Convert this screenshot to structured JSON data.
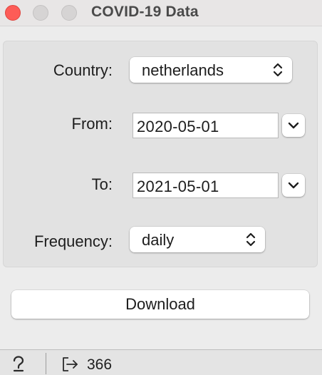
{
  "window": {
    "title": "COVID-19 Data"
  },
  "form": {
    "country": {
      "label": "Country:",
      "value": "netherlands"
    },
    "from": {
      "label": "From:",
      "value": "2020-05-01"
    },
    "to": {
      "label": "To:",
      "value": "2021-05-01"
    },
    "frequency": {
      "label": "Frequency:",
      "value": "daily"
    }
  },
  "actions": {
    "download_label": "Download"
  },
  "statusbar": {
    "output_count": "366"
  },
  "colors": {
    "close": "#fd5c57",
    "inactive_traffic": "#d6d4d4",
    "window_bg": "#ececec",
    "panel_bg": "#e2e2e2"
  }
}
